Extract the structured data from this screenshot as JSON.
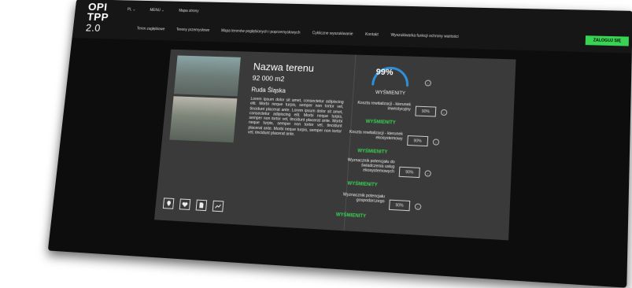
{
  "header": {
    "logo_line1": "OPI",
    "logo_line2": "TPP",
    "logo_version": "2.0",
    "lang_items": [
      "PL ⌄",
      "MENU ⌄",
      "Mapa strony"
    ],
    "menu_items": [
      "Teren zagłębiowe",
      "Tereny przemysłowe",
      "Mapa terenów poglębionych i poprzemysłowych",
      "Cykliczne wyszukiwanie",
      "Kontakt",
      "Wyszukiwarka funkcji ochrony wartości"
    ],
    "login_label": "ZALOGUJ SIĘ"
  },
  "site": {
    "title": "Nazwa terenu",
    "area": "92 000 m2",
    "city": "Ruda Śląska",
    "description": "Lorem ipsum dolor sit amet, consectetur adipiscing elit. Morbi neque turpis, semper non tortor vel, tincidunt placerat ante. Lorem ipsum dolor sit amet, consectetur adipiscing elit. Morbi neque turpis, semper non tortor vel, tincidunt placerat ante. Morbi neque turpis, semper non tortor vel, tincidunt placerat ante. Morbi neque turpis, semper non tortor vel, tincidunt placerat ante."
  },
  "gauge": {
    "value": "99%",
    "percent": 99,
    "label": "WYŚMIENITY",
    "color": "#2f8fd8"
  },
  "metrics": [
    {
      "label": "Koszta rewitalizacji - kierunek inwestycyjny",
      "value": "90%",
      "status": "WYŚMIENITY"
    },
    {
      "label": "Koszta rewitalizacji - kierunek ekosystemowy",
      "value": "90%",
      "status": "WYŚMIENITY"
    },
    {
      "label": "Wyznacznik potencjału do świadczenia usług ekosystemowych",
      "value": "90%",
      "status": "WYŚMIENITY"
    },
    {
      "label": "Wyznacznik potencjału gospodarczego",
      "value": "90%",
      "status": "WYŚMIENITY"
    }
  ],
  "icons": [
    "pin-icon",
    "heart-icon",
    "document-icon",
    "chart-icon"
  ],
  "colors": {
    "accent": "#39d353",
    "gauge": "#2f8fd8"
  }
}
